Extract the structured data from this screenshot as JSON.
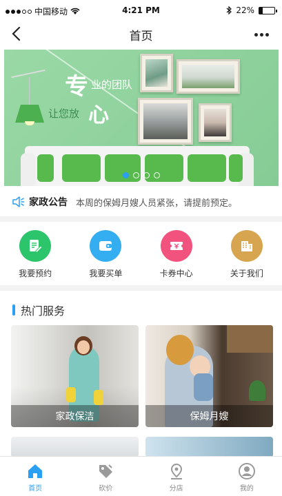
{
  "status_bar": {
    "carrier": "中国移动",
    "time": "4:21 PM",
    "battery": "22%",
    "battery_level": 0.22
  },
  "nav": {
    "title": "首页"
  },
  "banner": {
    "line1_big": "专",
    "line1_small": "业的团队",
    "line2_small": "让您放",
    "line2_big": "心",
    "page_count": 4,
    "active_page": 0
  },
  "notice": {
    "title": "家政公告",
    "text": "本周的保姆月嫂人员紧张，请提前预定。"
  },
  "actions": [
    {
      "label": "我要预约",
      "color": "#2dc56b",
      "icon": "document-edit-icon"
    },
    {
      "label": "我要买单",
      "color": "#34aef0",
      "icon": "wallet-icon"
    },
    {
      "label": "卡券中心",
      "color": "#f2527e",
      "icon": "coupon-yen-icon"
    },
    {
      "label": "关于我们",
      "color": "#d7a54f",
      "icon": "building-icon"
    }
  ],
  "section": {
    "title": "热门服务"
  },
  "services": [
    {
      "caption": "家政保洁"
    },
    {
      "caption": "保姆月嫂"
    }
  ],
  "tabs": [
    {
      "label": "首页",
      "icon": "home-icon"
    },
    {
      "label": "砍价",
      "icon": "price-tag-icon"
    },
    {
      "label": "分店",
      "icon": "location-pin-icon"
    },
    {
      "label": "我的",
      "icon": "user-icon"
    }
  ],
  "colors": {
    "accent": "#2b9ff2",
    "banner_green": "#8fd39e"
  }
}
